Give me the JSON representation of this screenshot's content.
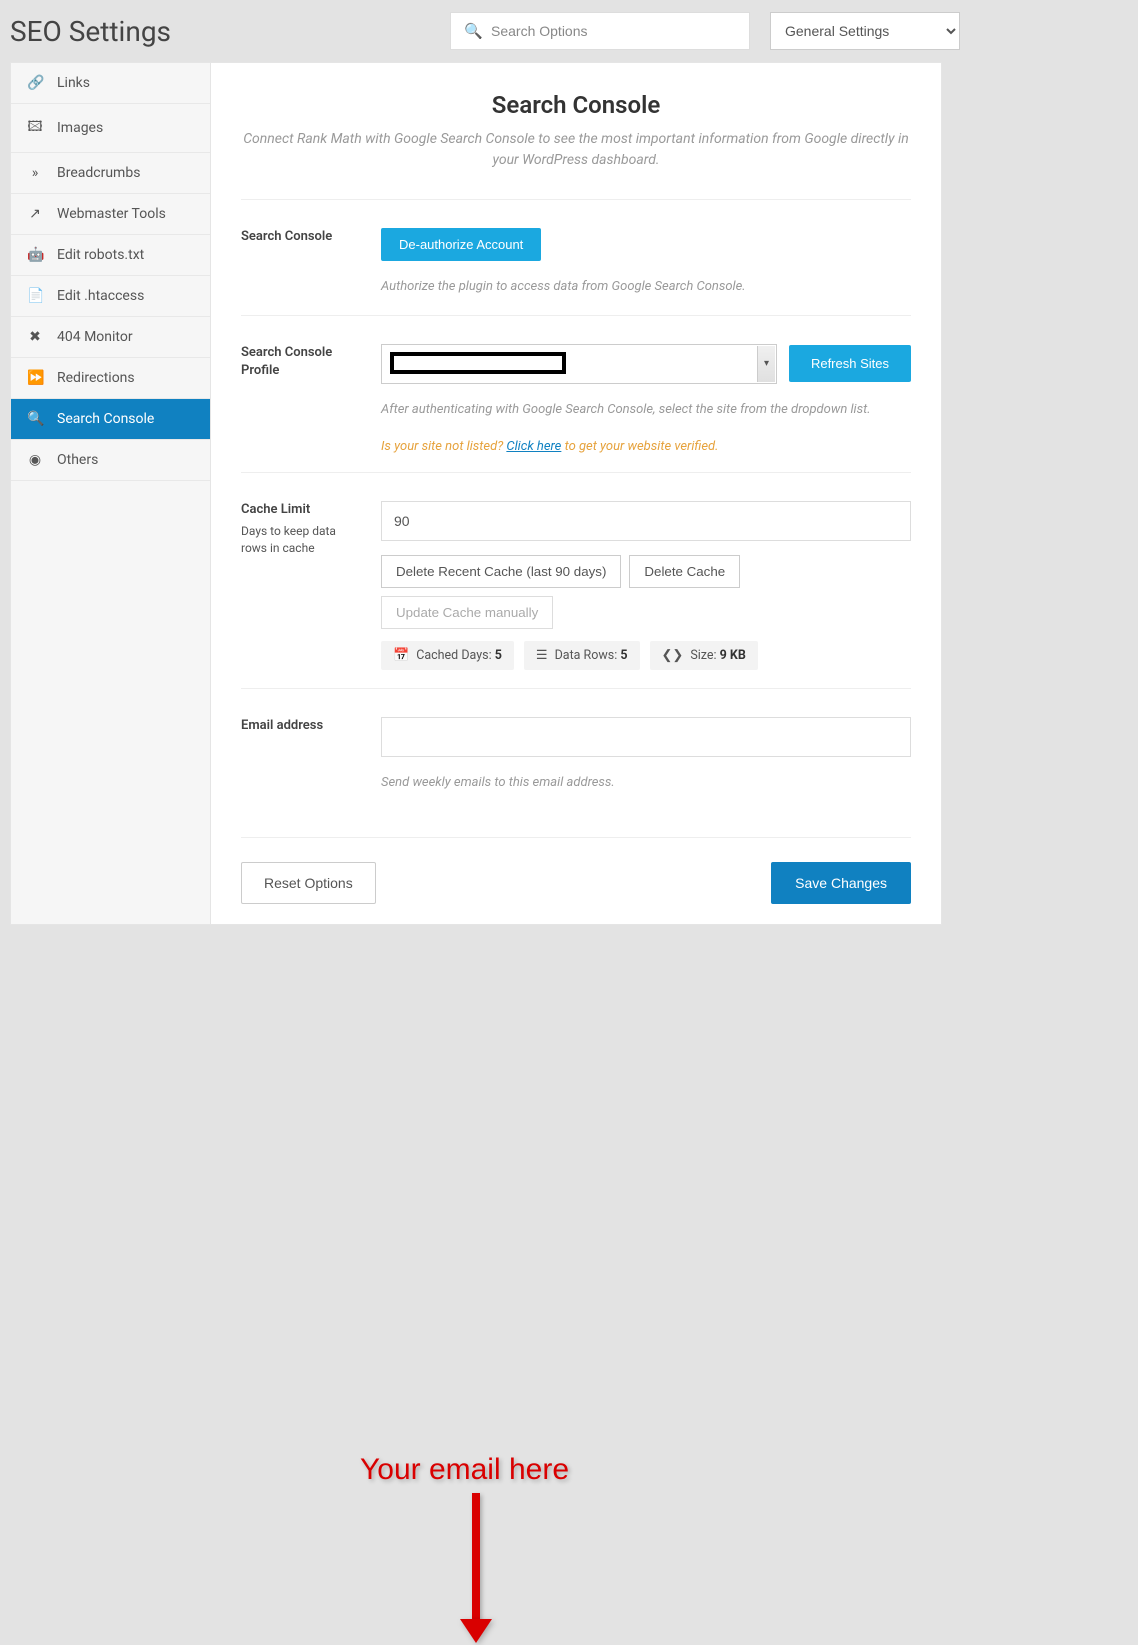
{
  "header": {
    "page_title": "SEO Settings",
    "search_placeholder": "Search Options",
    "dropdown_selected": "General Settings"
  },
  "sidebar": {
    "items": [
      {
        "icon": "link-icon",
        "glyph": "🔗",
        "label": "Links"
      },
      {
        "icon": "images-icon",
        "glyph": "🖾",
        "label": "Images"
      },
      {
        "icon": "breadcrumbs-icon",
        "glyph": "»",
        "label": "Breadcrumbs"
      },
      {
        "icon": "external-link-icon",
        "glyph": "↗",
        "label": "Webmaster Tools"
      },
      {
        "icon": "robots-icon",
        "glyph": "🤖",
        "label": "Edit robots.txt"
      },
      {
        "icon": "file-icon",
        "glyph": "📄",
        "label": "Edit .htaccess"
      },
      {
        "icon": "close-icon",
        "glyph": "✖",
        "label": "404 Monitor"
      },
      {
        "icon": "forward-icon",
        "glyph": "⏩",
        "label": "Redirections"
      },
      {
        "icon": "search-zoom-icon",
        "glyph": "🔍",
        "label": "Search Console",
        "active": true
      },
      {
        "icon": "circle-dot-icon",
        "glyph": "◉",
        "label": "Others"
      }
    ]
  },
  "main": {
    "title": "Search Console",
    "subtitle": "Connect Rank Math with Google Search Console to see the most important information from Google directly in your WordPress dashboard.",
    "sections": {
      "search_console": {
        "label": "Search Console",
        "button": "De-authorize Account",
        "help": "Authorize the plugin to access data from Google Search Console."
      },
      "profile": {
        "label": "Search Console Profile",
        "refresh_button": "Refresh Sites",
        "help": "After authenticating with Google Search Console, select the site from the dropdown list.",
        "warning_pre": "Is your site not listed? ",
        "warning_link": "Click here",
        "warning_post": " to get your website verified."
      },
      "cache": {
        "label": "Cache Limit",
        "sublabel": "Days to keep data rows in cache",
        "value": "90",
        "btn_delete_recent": "Delete Recent Cache (last 90 days)",
        "btn_delete": "Delete Cache",
        "btn_update": "Update Cache manually",
        "stats": {
          "cached_days_label": "Cached Days: ",
          "cached_days_value": "5",
          "data_rows_label": "Data Rows: ",
          "data_rows_value": "5",
          "size_label": "Size: ",
          "size_value": "9 KB"
        }
      },
      "email": {
        "label": "Email address",
        "value": "",
        "help": "Send weekly emails to this email address."
      }
    },
    "footer": {
      "reset": "Reset Options",
      "save": "Save Changes"
    }
  },
  "annotation": {
    "text": "Your email here"
  }
}
